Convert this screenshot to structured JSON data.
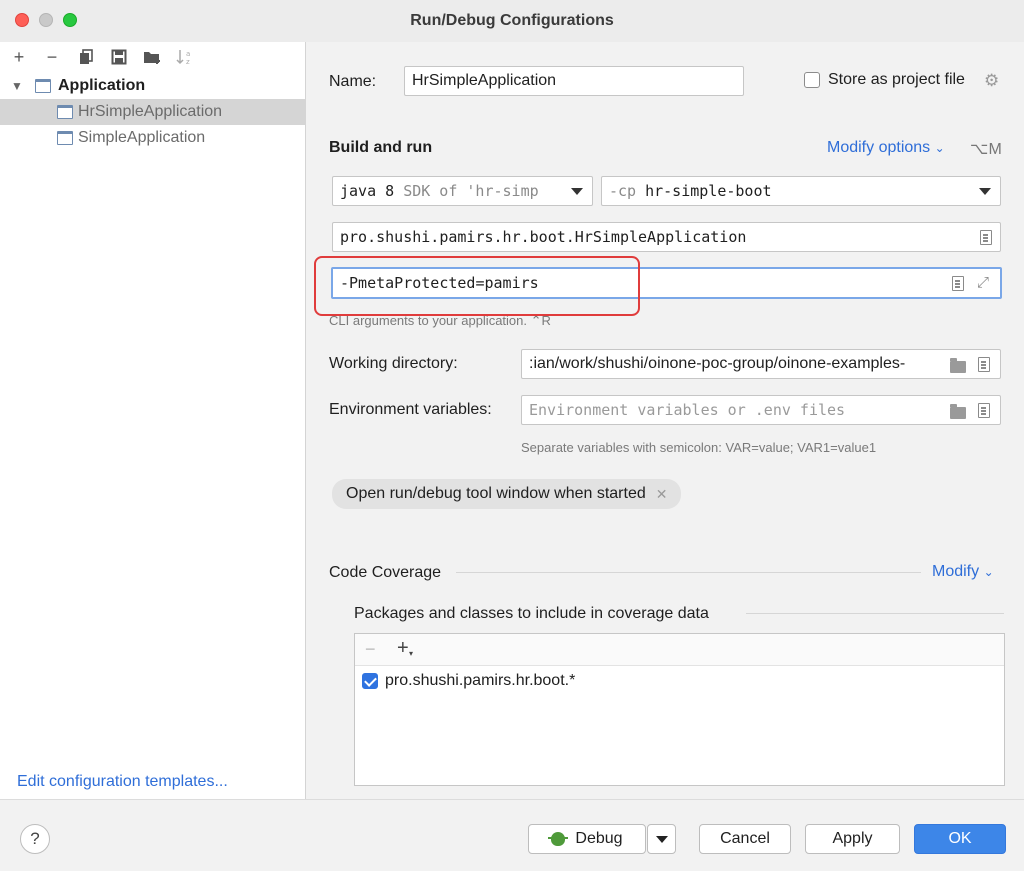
{
  "window": {
    "title": "Run/Debug Configurations"
  },
  "sidebar": {
    "group_label": "Application",
    "items": [
      {
        "label": "HrSimpleApplication",
        "selected": true
      },
      {
        "label": "SimpleApplication",
        "selected": false
      }
    ],
    "edit_templates_link": "Edit configuration templates..."
  },
  "form": {
    "name_label": "Name:",
    "name_value": "HrSimpleApplication",
    "store_label": "Store as project file",
    "store_checked": false,
    "build_run_heading": "Build and run",
    "modify_options_label": "Modify options",
    "modify_options_shortcut": "⌥M",
    "jdk_value": "java 8",
    "jdk_hint": "SDK of 'hr-simp",
    "cp_flag": "-cp",
    "cp_module": "hr-simple-boot",
    "main_class_value": "pro.shushi.pamirs.hr.boot.HrSimpleApplication",
    "program_args_value": "-PmetaProtected=pamirs",
    "program_args_hint": "CLI arguments to your application. ⌃R",
    "working_dir_label": "Working directory:",
    "working_dir_value": ":ian/work/shushi/oinone-poc-group/oinone-examples-",
    "env_label": "Environment variables:",
    "env_placeholder": "Environment variables or .env files",
    "env_hint": "Separate variables with semicolon: VAR=value; VAR1=value1",
    "open_tool_window_chip": "Open run/debug tool window when started",
    "chip_remove_glyph": "✕"
  },
  "coverage": {
    "heading": "Code Coverage",
    "modify_label": "Modify",
    "packages_heading": "Packages and classes to include in coverage data",
    "items": [
      {
        "label": "pro.shushi.pamirs.hr.boot.*",
        "checked": true
      }
    ]
  },
  "buttons": {
    "help": "?",
    "debug": "Debug",
    "cancel": "Cancel",
    "apply": "Apply",
    "ok": "OK"
  },
  "colors": {
    "accent": "#3d86e8",
    "link": "#2f6ed8",
    "highlight": "#e03c3c"
  }
}
